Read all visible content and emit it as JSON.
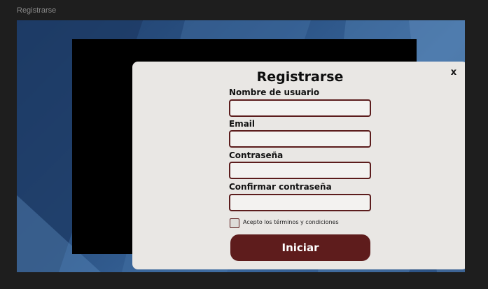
{
  "frame": {
    "label": "Registrarse"
  },
  "modal": {
    "title": "Registrarse",
    "close_label": "x",
    "fields": [
      {
        "label": "Nombre de usuario",
        "value": ""
      },
      {
        "label": "Email",
        "value": ""
      },
      {
        "label": "Contraseña",
        "value": ""
      },
      {
        "label": "Confirmar contraseña",
        "value": ""
      }
    ],
    "terms": {
      "label": "Acepto los términos y condiciones",
      "checked": false
    },
    "submit_label": "Iniciar"
  },
  "colors": {
    "accent": "#5e1c1c",
    "modal_bg": "#e9e7e4",
    "backdrop": "#2c5486",
    "page_bg": "#1e1e1e"
  }
}
